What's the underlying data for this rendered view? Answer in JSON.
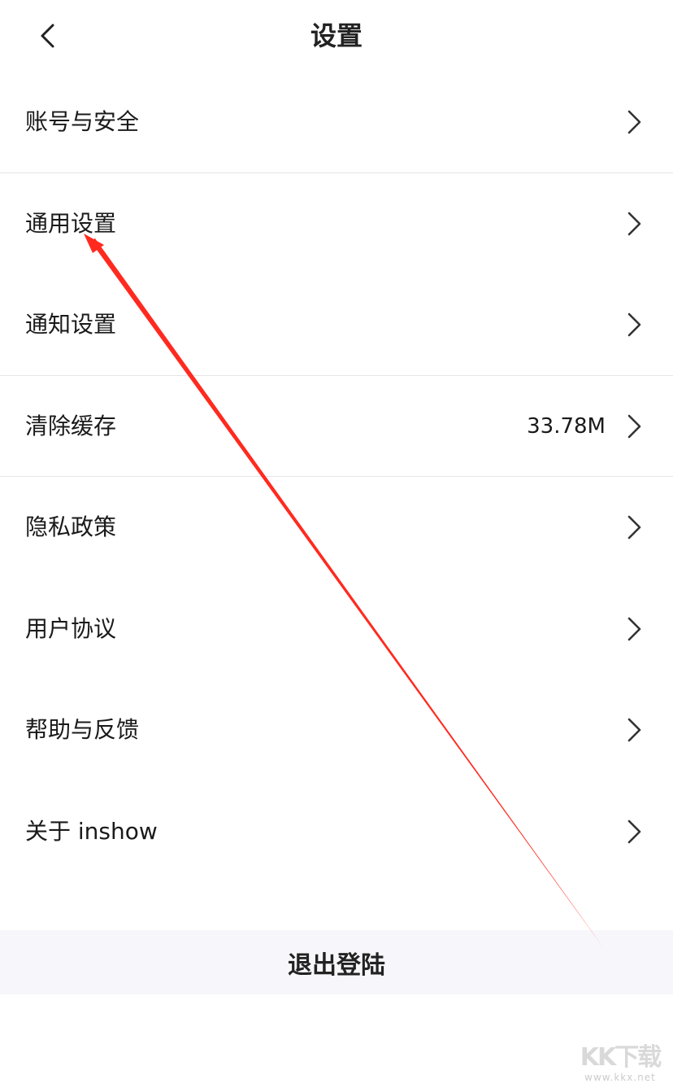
{
  "header": {
    "title": "设置",
    "back_icon": "chevron-left-icon"
  },
  "menu": {
    "items": [
      {
        "label": "账号与安全",
        "value": ""
      },
      {
        "label": "通用设置",
        "value": ""
      },
      {
        "label": "通知设置",
        "value": ""
      },
      {
        "label": "清除缓存",
        "value": "33.78M"
      },
      {
        "label": "隐私政策",
        "value": ""
      },
      {
        "label": "用户协议",
        "value": ""
      },
      {
        "label": "帮助与反馈",
        "value": ""
      },
      {
        "label": "关于 inshow",
        "value": ""
      }
    ],
    "chevron_icon": "chevron-right-icon"
  },
  "logout": {
    "label": "退出登陆"
  },
  "annotation": {
    "arrow_color": "#ff2a1f"
  },
  "watermark": {
    "logo": "KK下载",
    "url": "www.kkx.net"
  },
  "colors": {
    "background": "#ffffff",
    "divider": "#e5e5e5",
    "logout_bg": "#f7f6fa",
    "text": "#1a1a1a"
  }
}
